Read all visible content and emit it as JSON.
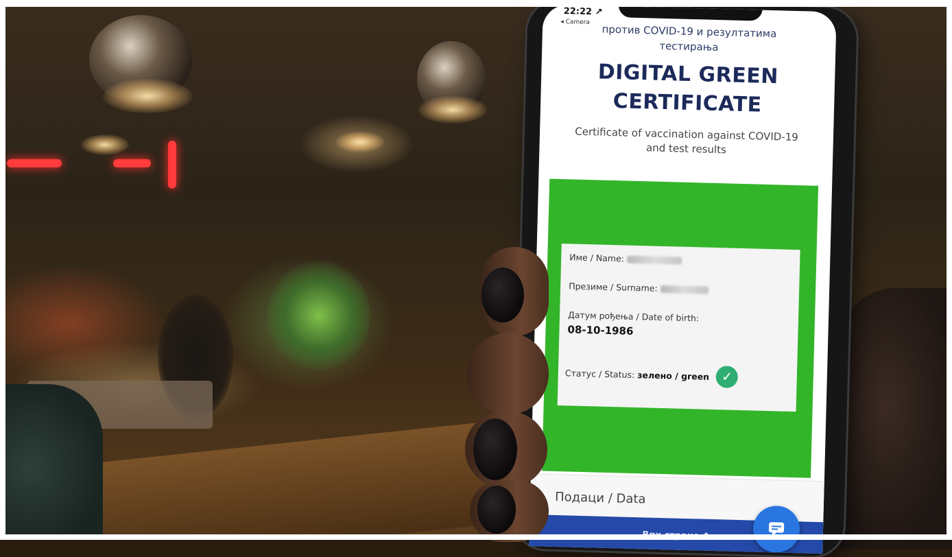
{
  "phone": {
    "status_time": "22:22 ↗",
    "status_back": "◂ Camera",
    "header_serbian_line1": "против COVID-19 и резултатима",
    "header_serbian_line2": "тестирања",
    "title_line1": "DIGITAL GREEN",
    "title_line2": "CERTIFICATE",
    "subtitle_line1": "Certificate of vaccination against COVID-19",
    "subtitle_line2": "and test results"
  },
  "certificate": {
    "name_label": "Име / Name:",
    "surname_label": "Презиме / Surname:",
    "dob_label": "Датум рођења / Date of birth:",
    "dob_value": "08-10-1986",
    "status_label": "Статус / Status:",
    "status_value": "зелено / green",
    "status_color": "#33b52a"
  },
  "footer": {
    "data_label": "Подаци / Data",
    "top_link": "Врх стране ↑"
  },
  "icons": {
    "check": "check-circle-icon",
    "chat": "chat-icon"
  }
}
